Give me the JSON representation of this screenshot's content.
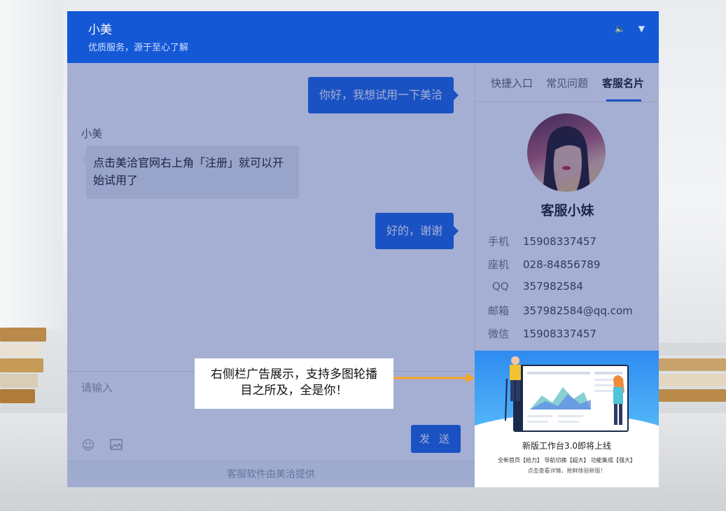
{
  "header": {
    "agent_name": "小美",
    "slogan": "优质服务，源于至心了解",
    "volume_icon": "speaker-icon",
    "menu_icon": "chevron-down-icon"
  },
  "chat": {
    "messages": [
      {
        "from": "user",
        "text": "你好，我想试用一下美洽"
      },
      {
        "from": "agent",
        "sender": "小美",
        "text": "点击美洽官网右上角「注册」就可以开始试用了"
      },
      {
        "from": "user",
        "text": "好的，谢谢"
      }
    ]
  },
  "composer": {
    "placeholder": "请输入",
    "emoji_icon": "emoji-icon",
    "image_icon": "image-icon",
    "send_label": "发 送",
    "footer": "客服软件由美洽提供"
  },
  "sidebar": {
    "tabs": [
      "快捷入口",
      "常见问题",
      "客服名片"
    ],
    "active_tab": "客服名片",
    "card": {
      "name": "客服小妹",
      "rows": [
        {
          "label": "手机",
          "value": "15908337457"
        },
        {
          "label": "座机",
          "value": "028-84856789"
        },
        {
          "label": "QQ",
          "value": "357982584"
        },
        {
          "label": "邮箱",
          "value": "357982584@qq.com"
        },
        {
          "label": "微信",
          "value": "15908337457"
        }
      ]
    }
  },
  "ad": {
    "title": "新版工作台3.0即将上线",
    "subtitle": "全新首页【给力】  导航切换【超大】  功能集成【强大】",
    "note": "点击查看详情，抢鲜体验新版！"
  },
  "callout": {
    "line1": "右侧栏广告展示，支持多图轮播",
    "line2": "目之所及，全是你！"
  },
  "colors": {
    "brand_blue": "#1558d6",
    "bubble_blue": "#1f6ae6",
    "arrow": "#f5a623"
  }
}
